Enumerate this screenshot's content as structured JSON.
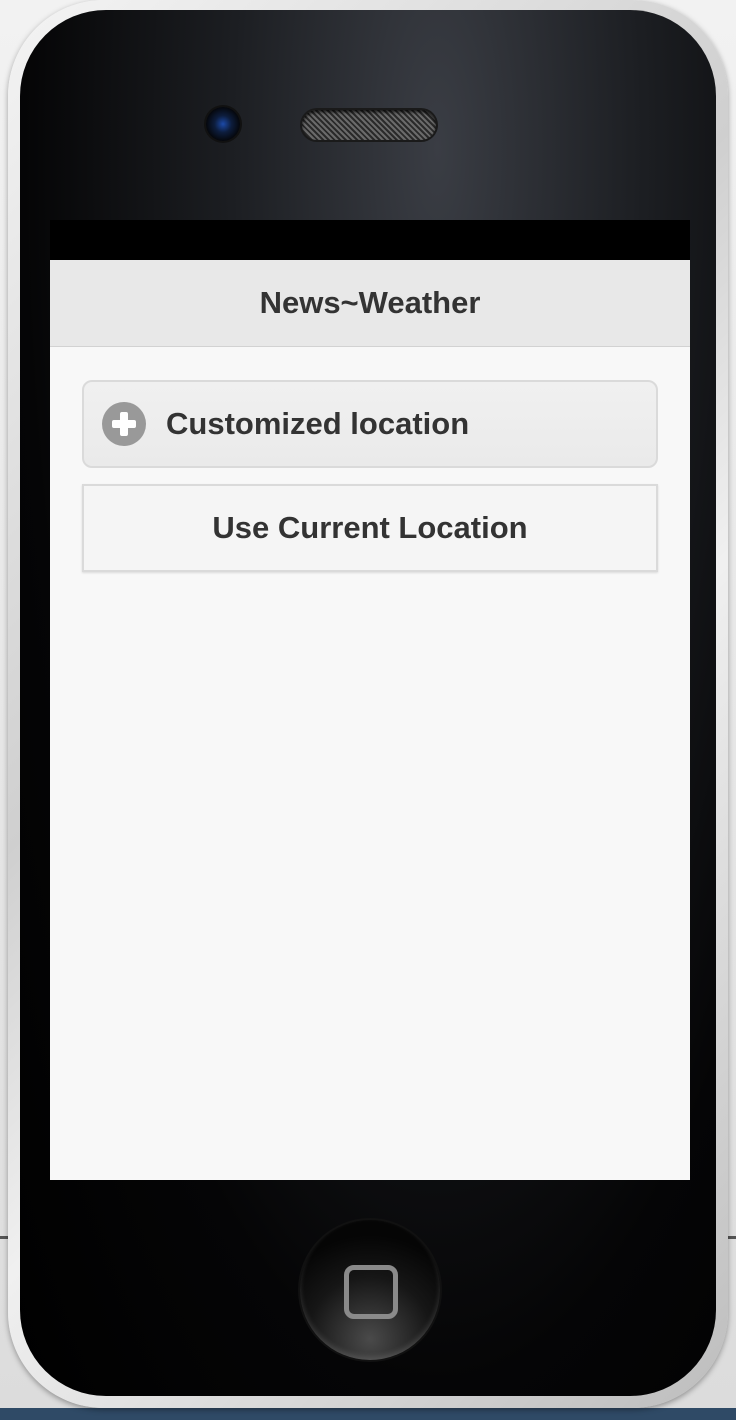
{
  "app": {
    "header_title": "News~Weather"
  },
  "actions": {
    "customized_location_label": "Customized location",
    "use_current_location_label": "Use Current Location"
  },
  "icons": {
    "customized_location_icon": "plus-circle-icon",
    "home_button_icon": "rounded-square-icon"
  },
  "colors": {
    "header_bg": "#e8e8e8",
    "screen_bg": "#f8f8f8",
    "text": "#333333",
    "icon_bg": "#999999",
    "status_bar_bg": "#000000"
  }
}
